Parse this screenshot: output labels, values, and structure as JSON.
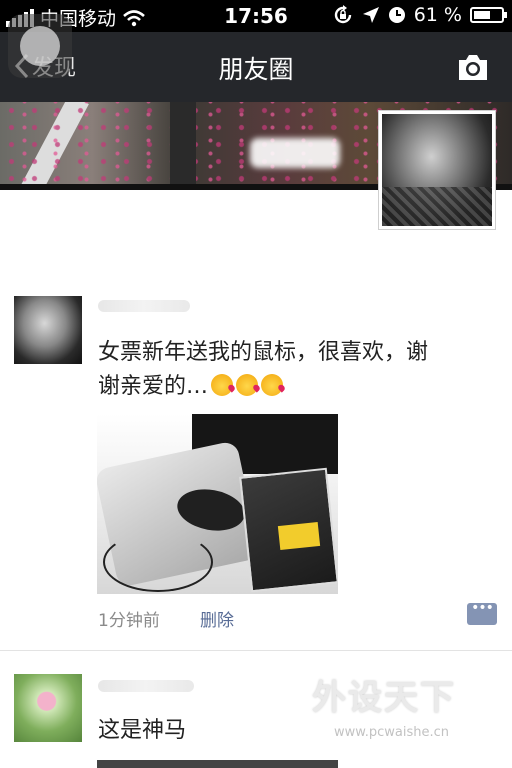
{
  "status_bar": {
    "carrier": "中国移动",
    "time": "17:56",
    "battery_text": "61 %",
    "battery_level": 0.61
  },
  "nav": {
    "back_label": "发现",
    "title": "朋友圈",
    "camera_icon": "camera-icon"
  },
  "posts": [
    {
      "text_line1": "女票新年送我的鼠标，很喜欢，谢",
      "text_line2": "谢亲爱的…",
      "emoji_count": 3,
      "time": "1分钟前",
      "delete_label": "删除"
    },
    {
      "text": "这是神马"
    }
  ],
  "watermark": {
    "logo": "外设天下",
    "url": "www.pcwaishe.cn"
  },
  "colors": {
    "nav_bg": "#25272b",
    "link_blue": "#576b95",
    "comment_button": "#8494b4"
  }
}
